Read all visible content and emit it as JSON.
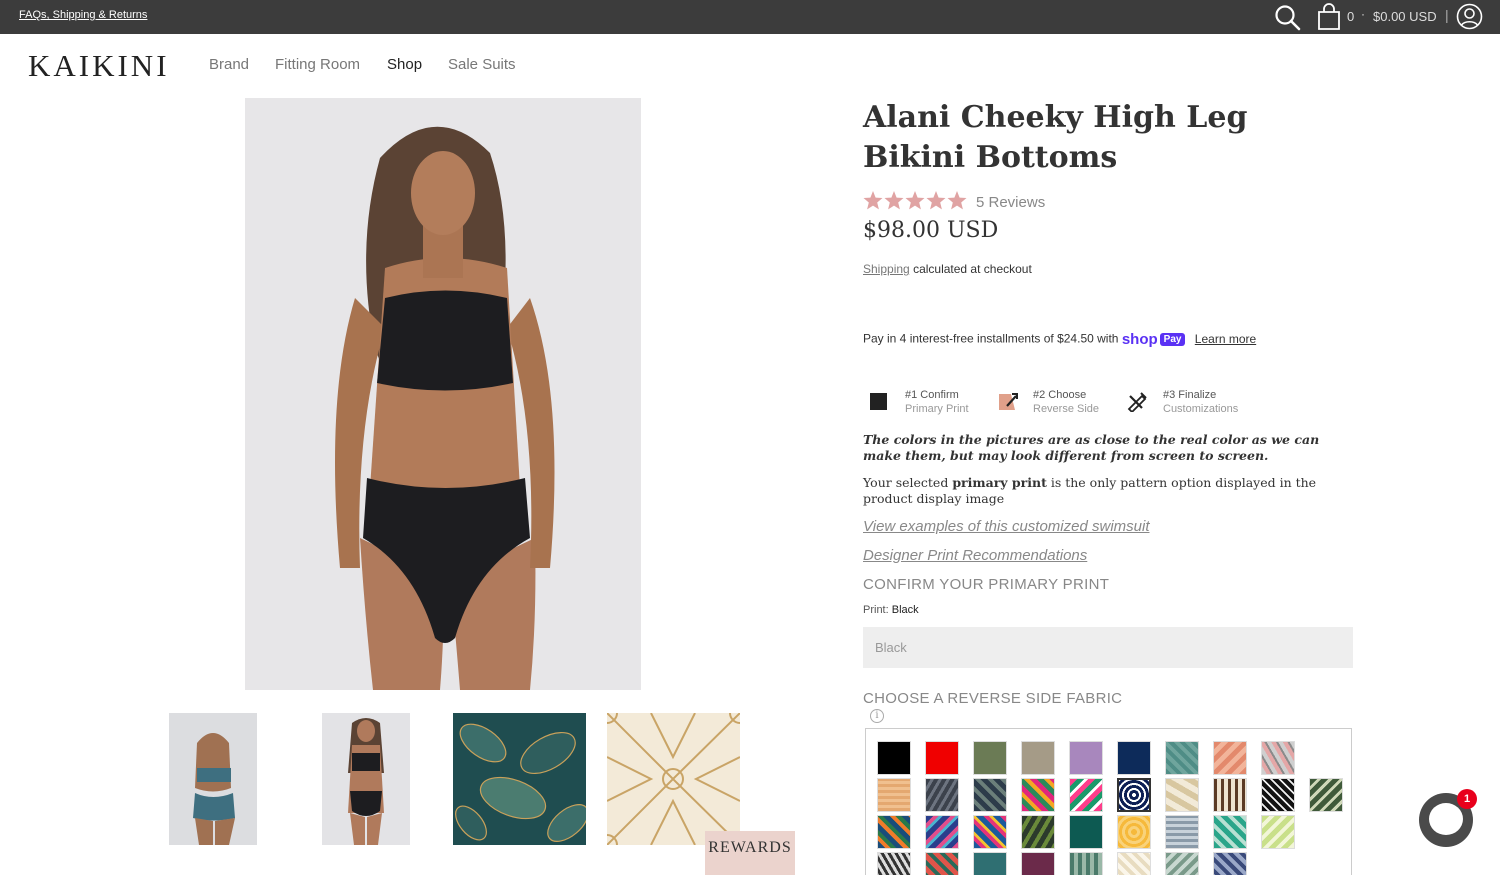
{
  "topbar": {
    "faq_link": "FAQs, Shipping & Returns",
    "cart_count": "0",
    "cart_separator": "·",
    "cart_total": "$0.00 USD",
    "divider": "|"
  },
  "header": {
    "logo": "KAIKINI",
    "nav": [
      "Brand",
      "Fitting Room",
      "Shop",
      "Sale Suits"
    ],
    "active_nav": "Shop"
  },
  "product": {
    "title": "Alani Cheeky High Leg Bikini Bottoms",
    "rating": 5,
    "rating_max": 5,
    "reviews": "5 Reviews",
    "price": "$98.00 USD",
    "shipping_link": "Shipping",
    "shipping_text": "calculated at checkout",
    "pay_text": "Pay in 4 interest-free installments of $24.50 with",
    "shoppay_word": "shop",
    "shoppay_box": "Pay",
    "learn_more": "Learn more"
  },
  "steps": [
    {
      "line1": "#1 Confirm",
      "line2": "Primary Print",
      "icon": "black-square-icon"
    },
    {
      "line1": "#2 Choose",
      "line2": "Reverse Side",
      "icon": "reverse-fabric-icon"
    },
    {
      "line1": "#3 Finalize",
      "line2": "Customizations",
      "icon": "pencil-ruler-icon"
    }
  ],
  "notes": {
    "colors_note": "The colors in the pictures are as close to the real color as we can make them, but may look different from screen to screen.",
    "selected_pre": "Your selected",
    "selected_bold": "primary print",
    "selected_post": "is the only pattern option displayed in the product display image",
    "examples_link": "View examples of this customized swimsuit",
    "designer_link": "Designer Print Recommendations"
  },
  "primary_print": {
    "heading": "CONFIRM YOUR PRIMARY PRINT",
    "label": "Print:",
    "value": "Black",
    "select_value": "Black"
  },
  "reverse": {
    "heading": "CHOOSE A REVERSE SIDE FABRIC",
    "info_glyph": "i"
  },
  "rewards_label": "REWARDS",
  "chat_badge": "1",
  "colors": {
    "topbar": "#3c3c3c",
    "star": "#e0a3a3",
    "shoppay": "#5a31f4",
    "rewards_bg": "#ebd3cd",
    "chat_badge": "#e8001c"
  }
}
